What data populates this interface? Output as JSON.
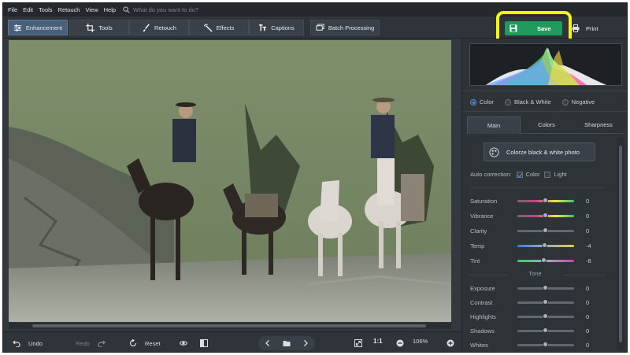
{
  "menu": {
    "items": [
      "File",
      "Edit",
      "Tools",
      "Retouch",
      "View",
      "Help"
    ],
    "search_placeholder": "What do you want to do?"
  },
  "tabs": [
    {
      "label": "Enhancement",
      "icon": "sliders-icon",
      "active": true
    },
    {
      "label": "Tools",
      "icon": "crop-icon"
    },
    {
      "label": "Retouch",
      "icon": "brush-icon"
    },
    {
      "label": "Effects",
      "icon": "magic-wand-icon"
    },
    {
      "label": "Captions",
      "icon": "text-icon"
    },
    {
      "label": "Batch Processing",
      "icon": "batch-icon"
    }
  ],
  "actions": {
    "save": "Save",
    "print": "Print"
  },
  "colors": {
    "accent": "#4a90e2",
    "save_green": "#1f9b5d",
    "highlight": "#f5f50f"
  },
  "mode": {
    "options": [
      "Color",
      "Black & White",
      "Negative"
    ],
    "selected": "Color"
  },
  "subtabs": [
    "Main",
    "Colors",
    "Sharpness"
  ],
  "colorize_label": "Colorze black & white photo",
  "autocorrection": {
    "label": "Auto correction:",
    "color": "Color",
    "light": "Light",
    "color_checked": true,
    "light_checked": false
  },
  "sliders": [
    {
      "label": "Saturation",
      "value": "0"
    },
    {
      "label": "Vibrance",
      "value": "0"
    },
    {
      "label": "Clarity",
      "value": "0"
    },
    {
      "label": "Temp",
      "value": "-4"
    },
    {
      "label": "Tint",
      "value": "-8"
    }
  ],
  "tone": {
    "title": "Tone",
    "sliders": [
      {
        "label": "Exposure",
        "value": "0"
      },
      {
        "label": "Contrast",
        "value": "0"
      },
      {
        "label": "Highlights",
        "value": "0"
      },
      {
        "label": "Shadows",
        "value": "0"
      },
      {
        "label": "Whites",
        "value": "0"
      }
    ]
  },
  "bottom": {
    "undo": "Undo",
    "redo": "Redo",
    "reset": "Reset",
    "ratio": "1:1",
    "zoom": "106%"
  }
}
